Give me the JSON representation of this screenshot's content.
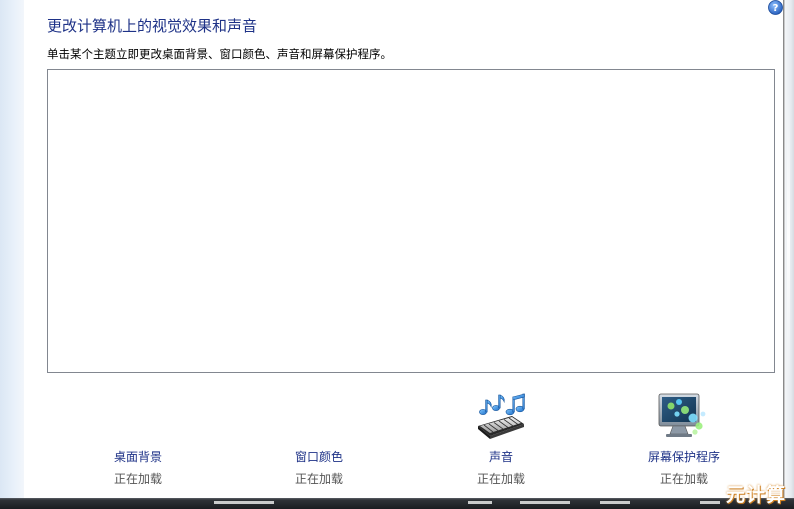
{
  "header": {
    "title": "更改计算机上的视觉效果和声音",
    "subtitle": "单击某个主题立即更改桌面背景、窗口颜色、声音和屏幕保护程序。"
  },
  "help": {
    "icon": "help-icon",
    "color": "#2a6ac4"
  },
  "items": [
    {
      "label": "桌面背景",
      "status": "正在加载"
    },
    {
      "label": "窗口颜色",
      "status": "正在加载"
    },
    {
      "label": "声音",
      "status": "正在加载",
      "icon": "sound-icon"
    },
    {
      "label": "屏幕保护程序",
      "status": "正在加载",
      "icon": "screensaver-icon"
    }
  ],
  "watermark": "元计算",
  "colors": {
    "link": "#1e3287",
    "title": "#1e3287",
    "border": "#828790"
  }
}
